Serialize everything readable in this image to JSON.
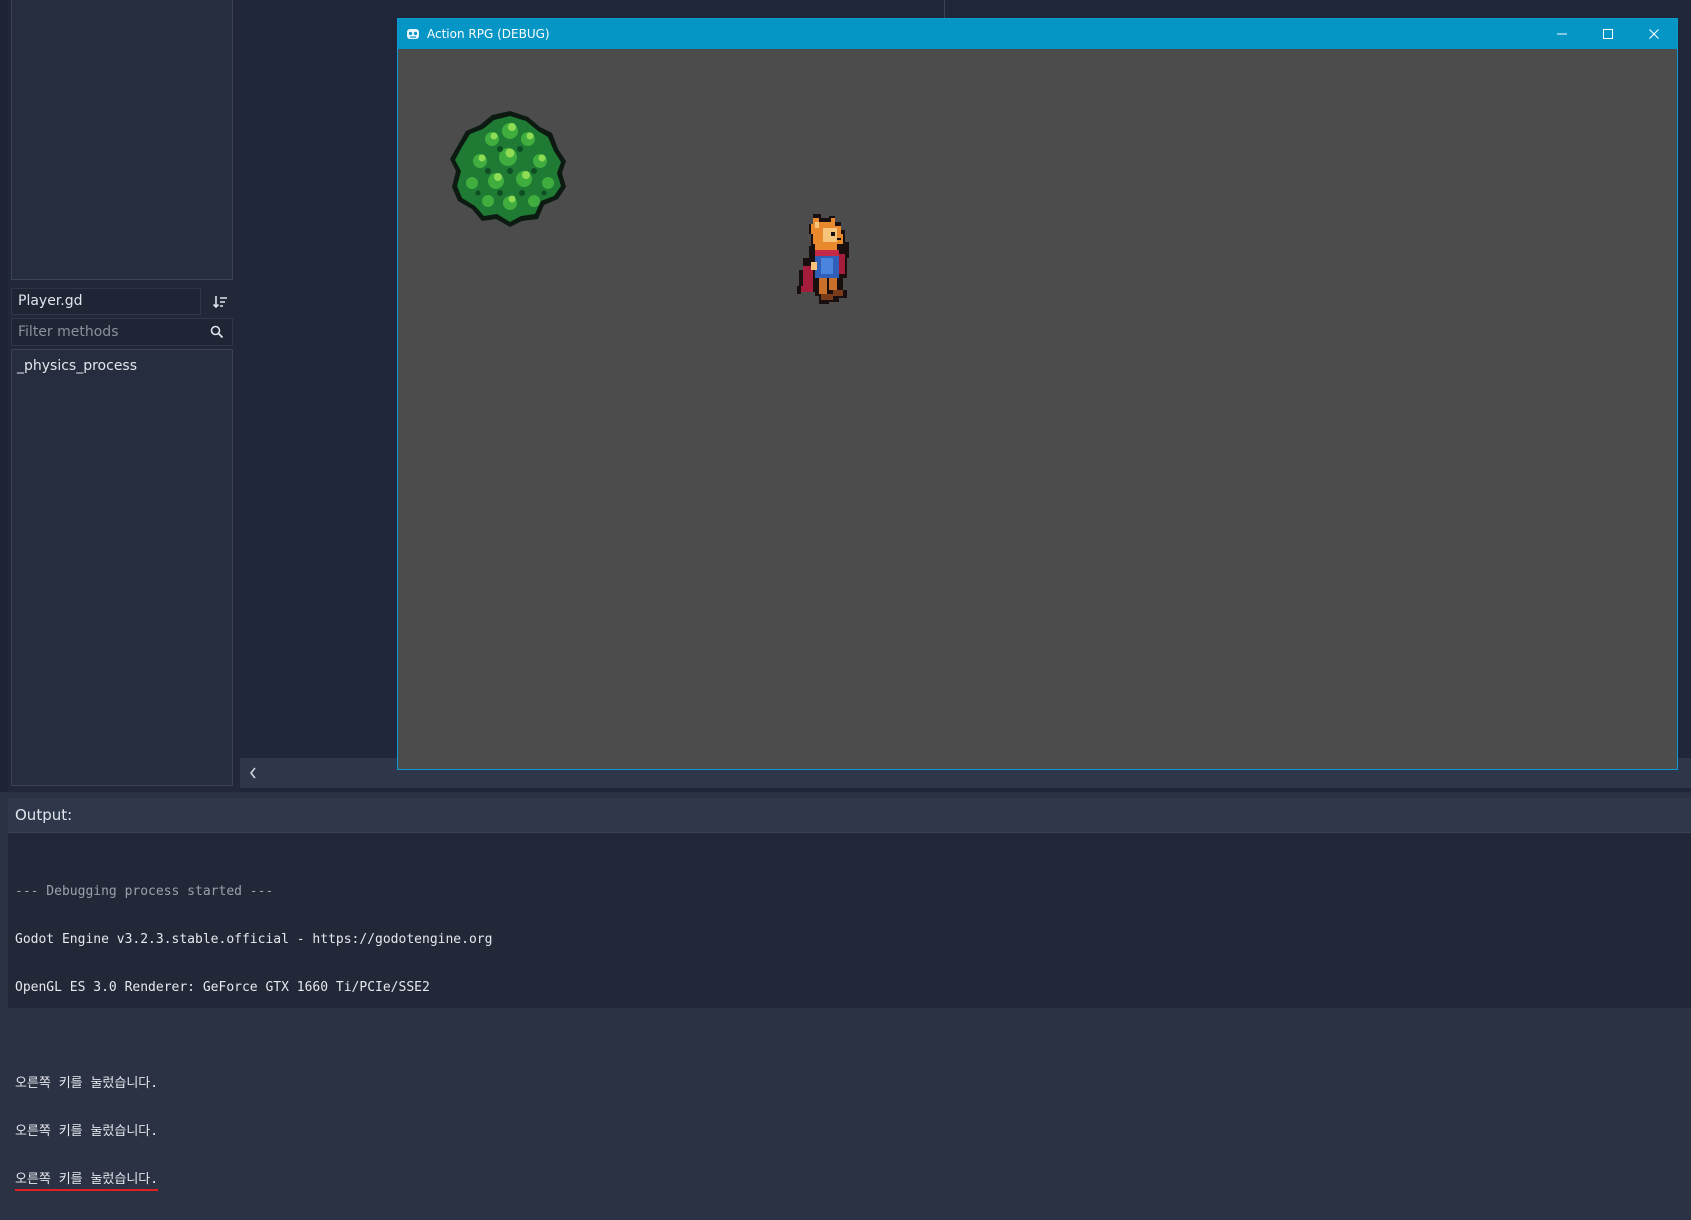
{
  "script_panel": {
    "script_name": "Player.gd",
    "filter_placeholder": "Filter methods",
    "methods": [
      "_physics_process"
    ]
  },
  "game_window": {
    "title": "Action RPG (DEBUG)"
  },
  "output": {
    "title": "Output:",
    "lines": [
      "--- Debugging process started ---",
      "Godot Engine v3.2.3.stable.official - https://godotengine.org",
      "OpenGL ES 3.0 Renderer: GeForce GTX 1660 Ti/PCIe/SSE2",
      "",
      "오른쪽 키를 눌렀습니다.",
      "오른쪽 키를 눌렀습니다.",
      "오른쪽 키를 눌렀습니다."
    ]
  },
  "colors": {
    "title_bar": "#0696c5",
    "viewport_bg": "#4c4c4c",
    "editor_bg": "#222838",
    "underline_accent": "#e02020"
  },
  "icons": [
    "sort-icon",
    "search-icon",
    "godot-app-icon",
    "minimize-icon",
    "maximize-icon",
    "close-icon",
    "collapse-left-icon"
  ]
}
